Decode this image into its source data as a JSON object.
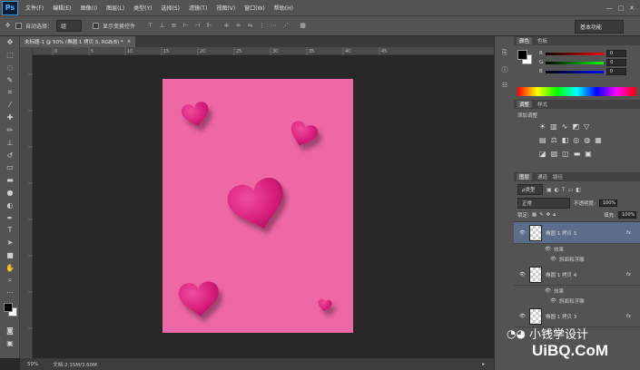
{
  "app": {
    "logo": "Ps"
  },
  "menu": [
    "文件(F)",
    "编辑(E)",
    "图像(I)",
    "图层(L)",
    "类型(Y)",
    "选择(S)",
    "滤镜(T)",
    "视图(V)",
    "窗口(W)",
    "帮助(H)"
  ],
  "window_controls": [
    "—",
    "□",
    "✕"
  ],
  "options": {
    "auto_select_label": "自动选择：",
    "auto_select_value": "组",
    "show_transform_label": "显示变换控件",
    "workspace": "基本功能"
  },
  "document": {
    "tab_title": "未标题-1 @ 50% (椭圆 1 拷贝 5, RGB/8) *",
    "close": "×"
  },
  "ruler_ticks": [
    "0",
    "5",
    "10",
    "15",
    "20",
    "25",
    "30",
    "35",
    "40",
    "45"
  ],
  "status": {
    "zoom": "50%",
    "doc_info": "文档:2.15M/3.60M"
  },
  "color_panel": {
    "tabs": [
      "颜色",
      "色板"
    ],
    "rows": [
      {
        "label": "R",
        "value": "0"
      },
      {
        "label": "G",
        "value": "0"
      },
      {
        "label": "B",
        "value": "0"
      }
    ]
  },
  "adjust_panel": {
    "tabs": [
      "调整",
      "样式"
    ],
    "title": "添加调整"
  },
  "layers_panel": {
    "tabs": [
      "图层",
      "通道",
      "路径"
    ],
    "filter": "ρ类型",
    "blend_mode": "正常",
    "opacity_label": "不透明度:",
    "opacity": "100%",
    "lock_label": "锁定:",
    "fill_label": "填充:",
    "fill": "100%",
    "layers": [
      {
        "name": "椭圆 1 拷贝 5",
        "fx": "fx",
        "effects_label": "效果",
        "effect": "斜面和浮雕",
        "selected": true
      },
      {
        "name": "椭圆 1 拷贝 4",
        "fx": "fx",
        "effects_label": "效果",
        "effect": "斜面和浮雕",
        "selected": false
      },
      {
        "name": "椭圆 1 拷贝 3",
        "fx": "fx",
        "effects_label": "效果",
        "effect": "",
        "selected": false
      }
    ]
  },
  "watermark": {
    "text1": "小钱学设计",
    "text2": "UiBQ.CoM"
  },
  "colors": {
    "canvas": "#ef68a6",
    "heart": "#d81f7c",
    "selected_layer": "#5b6d8a"
  }
}
